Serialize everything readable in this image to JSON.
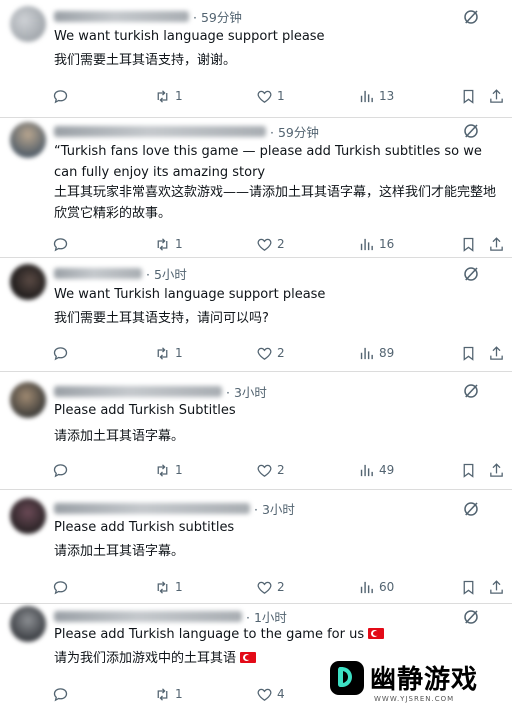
{
  "tweets": [
    {
      "time": "· 59分钟",
      "text_en": "We want turkish language support please",
      "text_cn": "我们需要土耳其语支持，谢谢。",
      "retweets": "1",
      "likes": "1",
      "views": "13"
    },
    {
      "time": "· 59分钟",
      "text_en": "“Turkish fans love this game — please add Turkish subtitles so we can fully enjoy its amazing story",
      "text_cn": "土耳其玩家非常喜欢这款游戏——请添加土耳其语字幕，这样我们才能完整地欣赏它精彩的故事。",
      "retweets": "1",
      "likes": "2",
      "views": "16"
    },
    {
      "time": "· 5小时",
      "text_en": "We want Turkish language support please",
      "text_cn": "我们需要土耳其语支持，请问可以吗?",
      "retweets": "1",
      "likes": "2",
      "views": "89"
    },
    {
      "time": "· 3小时",
      "text_en": "Please add Turkish Subtitles",
      "text_cn": "请添加土耳其语字幕。",
      "retweets": "1",
      "likes": "2",
      "views": "49"
    },
    {
      "time": "· 3小时",
      "text_en": "Please add Turkish subtitles",
      "text_cn": "请添加土耳其语字幕。",
      "retweets": "1",
      "likes": "2",
      "views": "60"
    },
    {
      "time": "· 1小时",
      "text_en": "Please add Turkish language to the game for us",
      "text_cn": "请为我们添加游戏中的土耳其语",
      "retweets": "1",
      "likes": "4",
      "views": ""
    }
  ],
  "watermark": {
    "brand": "幽静游戏",
    "url": "WWW.YJSREN.COM"
  },
  "icons": {
    "reply": "reply-icon",
    "retweet": "retweet-icon",
    "like": "heart-icon",
    "views": "views-icon",
    "bookmark": "bookmark-icon",
    "share": "share-icon",
    "grok": "grok-icon",
    "flag": "turkey-flag-icon"
  },
  "colors": {
    "text": "#0f1419",
    "muted": "#536471",
    "divider": "#dcdcdc",
    "flag": "#e30a17"
  }
}
